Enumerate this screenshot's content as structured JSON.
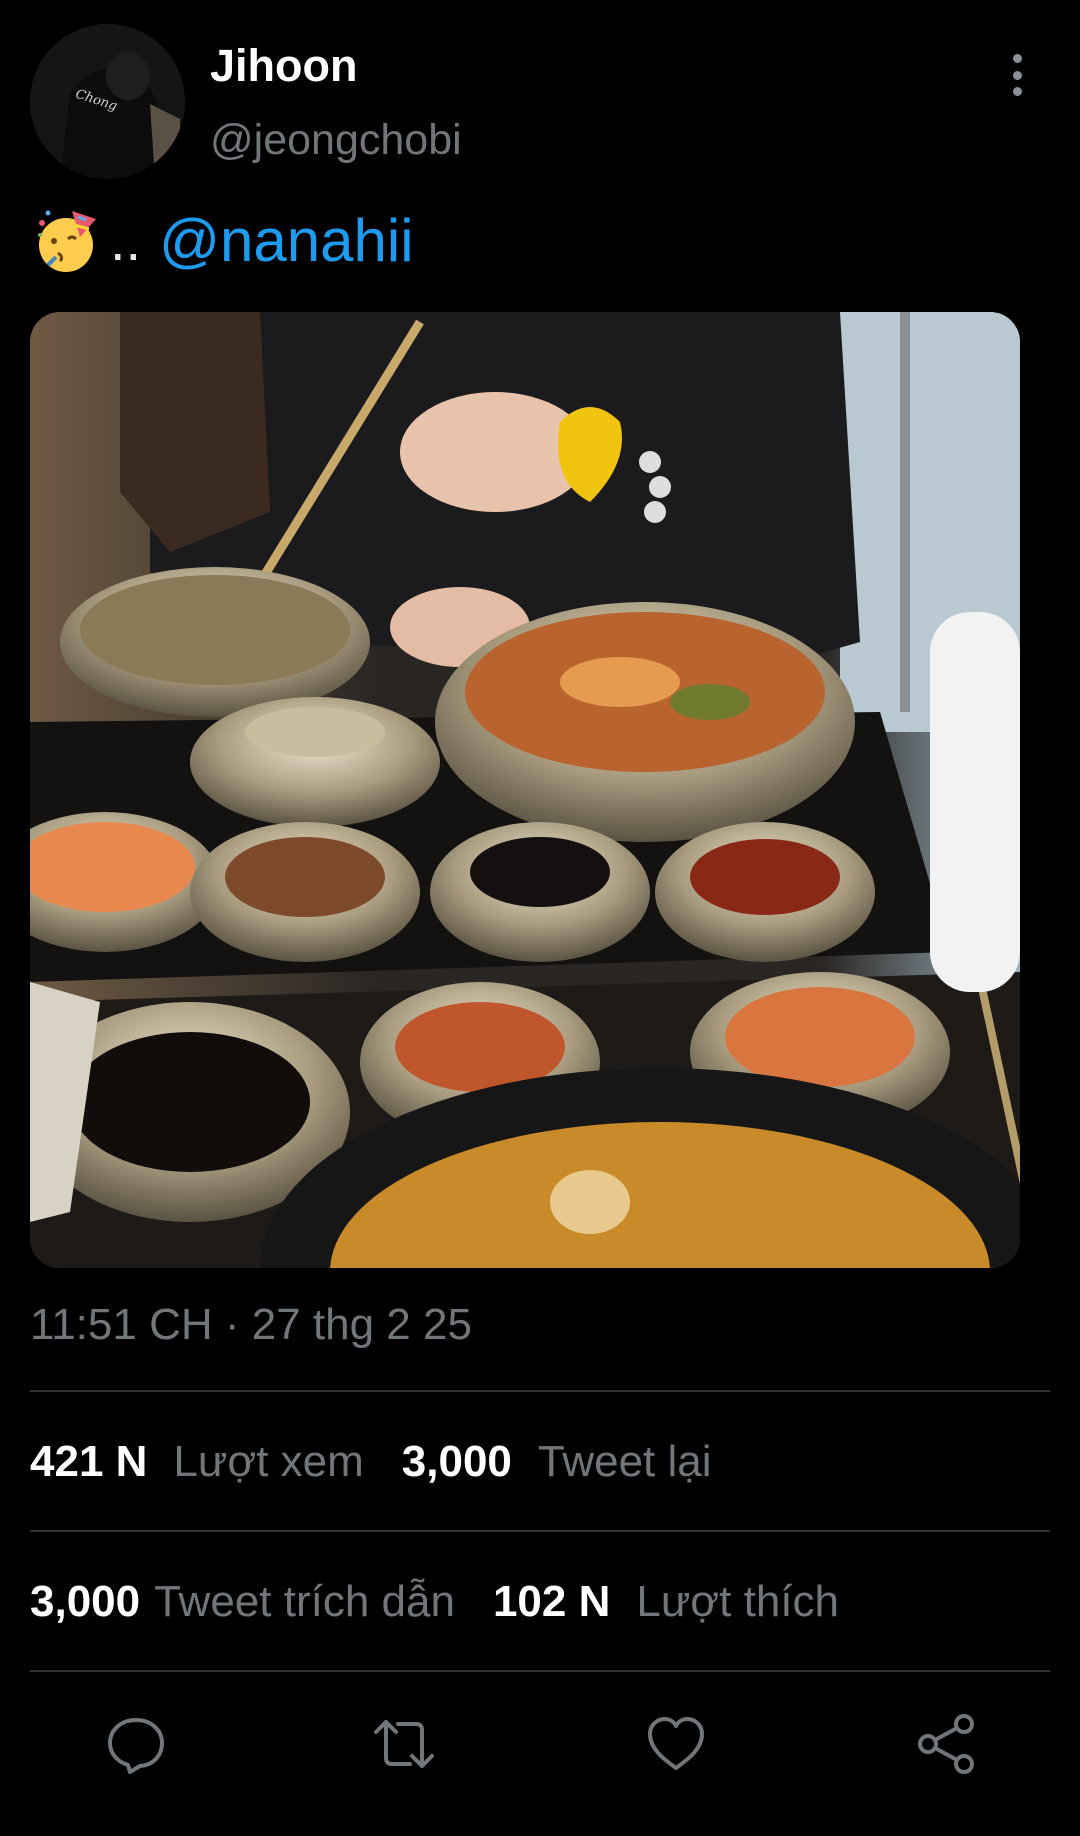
{
  "author": {
    "display_name": "Jihoon",
    "handle": "@jeongchobi",
    "avatar_text": "Chong"
  },
  "tweet": {
    "emoji": "partying-face-emoji",
    "text_dots": "..",
    "mention": "@nanahii"
  },
  "photo": {
    "description_icon": "photo-korean-meal"
  },
  "meta": {
    "timestamp": "11:51 CH · 27 thg 2 25"
  },
  "stats": {
    "views_count": "421 N",
    "views_label": "Lượt xem",
    "retweets_count": "3,000",
    "retweets_label": "Tweet lại",
    "quotes_count": "3,000",
    "quotes_label": "Tweet trích dẫn",
    "likes_count": "102 N",
    "likes_label": "Lượt thích"
  },
  "actions": {
    "reply_icon": "reply-icon",
    "retweet_icon": "retweet-icon",
    "like_icon": "heart-icon",
    "share_icon": "share-icon"
  },
  "colors": {
    "background": "#000000",
    "mention": "#1d9bf0",
    "secondary_text": "#71767b",
    "divider": "#2f3336"
  }
}
